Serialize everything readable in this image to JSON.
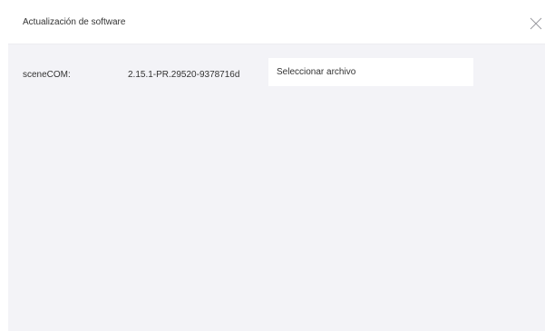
{
  "dialog": {
    "title": "Actualización de software",
    "close_icon": "close-icon"
  },
  "software": {
    "label": "sceneCOM:",
    "version": "2.15.1-PR.29520-9378716d",
    "select_file_label": "Seleccionar archivo"
  }
}
